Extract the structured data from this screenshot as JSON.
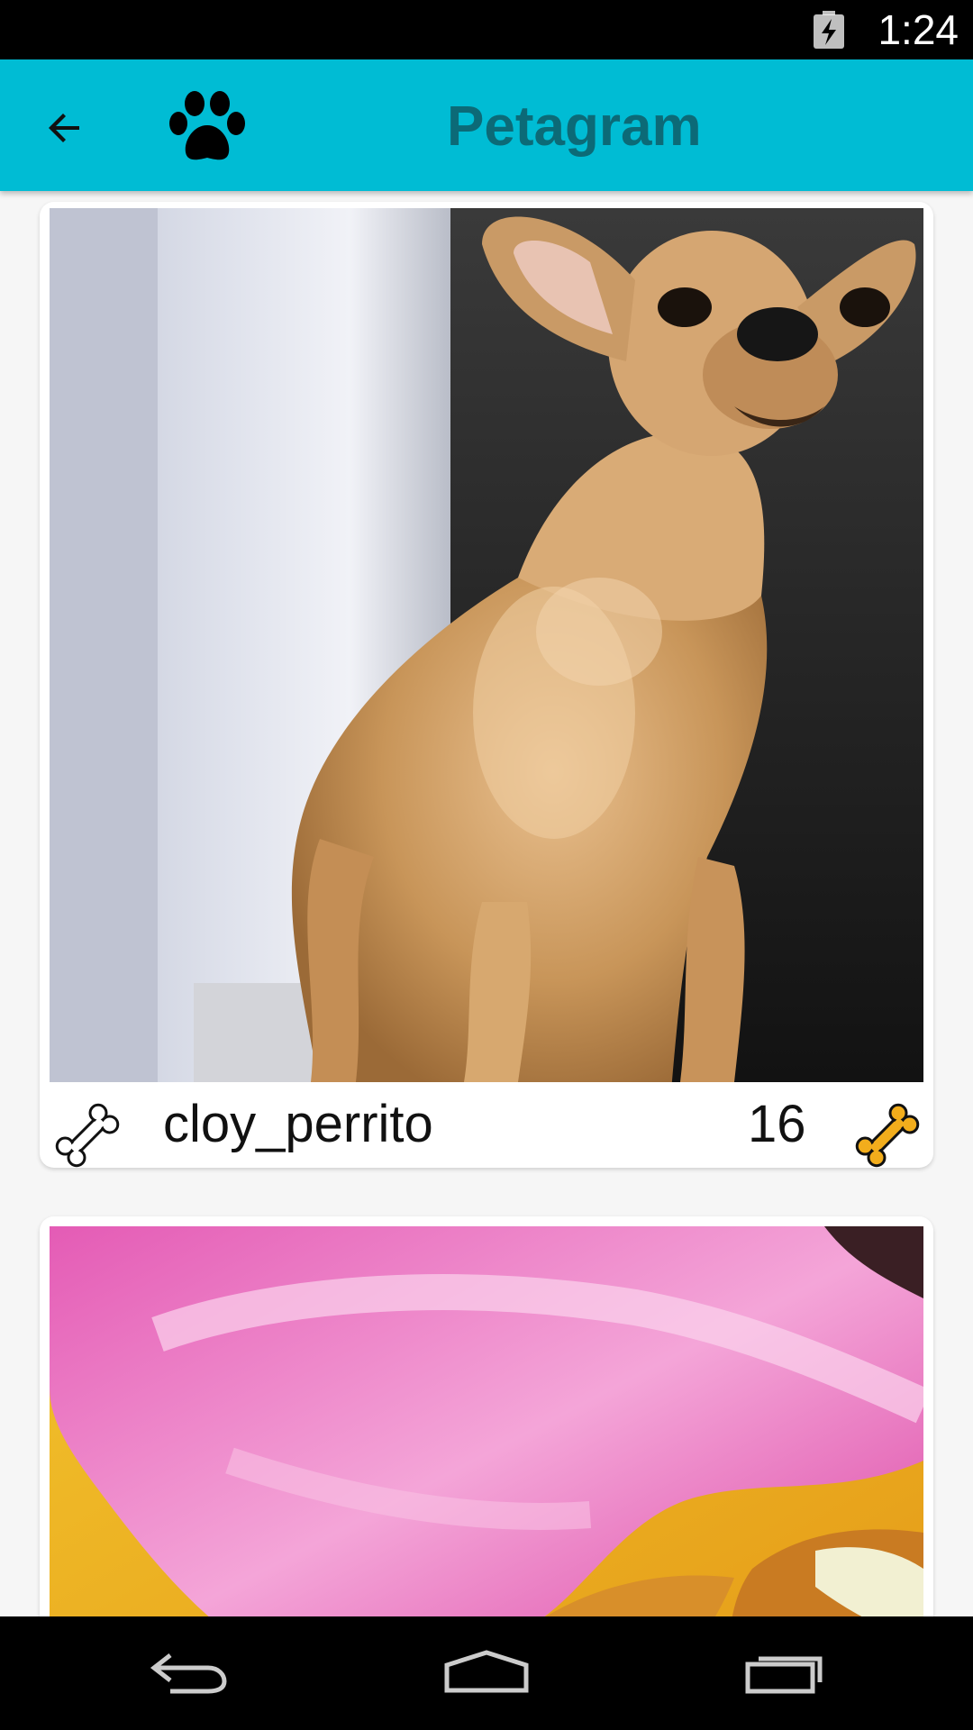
{
  "status_bar": {
    "time": "1:24",
    "battery_icon": "battery-charging-icon"
  },
  "toolbar": {
    "title": "Petagram",
    "back_icon": "arrow-back-icon",
    "logo_icon": "paw-icon",
    "background_color": "#00bcd4",
    "title_color": "#0c6a77"
  },
  "feed": {
    "posts": [
      {
        "username": "cloy_perrito",
        "likes": "16",
        "photo": "chihuahua-photo",
        "rate_icon": "bone-outline-icon",
        "likes_icon": "bone-filled-icon"
      },
      {
        "photo": "pink-blanket-dog-photo"
      }
    ]
  },
  "nav_bar": {
    "back_icon": "nav-back-icon",
    "home_icon": "nav-home-icon",
    "recents_icon": "nav-recents-icon"
  }
}
